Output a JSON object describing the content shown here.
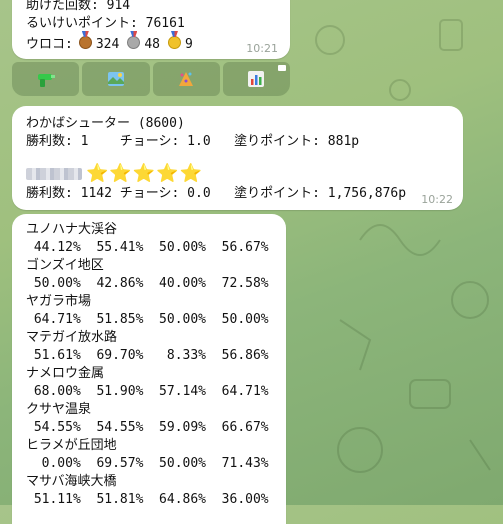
{
  "msg1": {
    "help_count": "助けた回数: 914",
    "points": "るいけいポイント: 76161",
    "scales_label": "ウロコ:",
    "bronze": "324",
    "silver": "48",
    "gold": "9",
    "time": "10:21"
  },
  "keyboard": {
    "buttons": [
      {
        "icon": "green-squirt-gun-icon"
      },
      {
        "icon": "map-stage-icon"
      },
      {
        "icon": "festival-icon"
      },
      {
        "icon": "bar-chart-icon"
      }
    ]
  },
  "msg2": {
    "weapon": "わかばシューター (8600)",
    "line2": "勝利数: 1    チョーシ: 1.0   塗りポイント: 881p",
    "stars": "⭐⭐⭐⭐⭐",
    "line4": "勝利数: 1142 チョーシ: 0.0   塗りポイント: 1,756,876p",
    "time": "10:22"
  },
  "msg3": {
    "stages": [
      {
        "name": "ユノハナ大渓谷",
        "rates": " 44.12%  55.41%  50.00%  56.67%"
      },
      {
        "name": "ゴンズイ地区",
        "rates": " 50.00%  42.86%  40.00%  72.58%"
      },
      {
        "name": "ヤガラ市場",
        "rates": " 64.71%  51.85%  50.00%  50.00%"
      },
      {
        "name": "マテガイ放水路",
        "rates": " 51.61%  69.70%   8.33%  56.86%"
      },
      {
        "name": "ナメロウ金属",
        "rates": " 68.00%  51.90%  57.14%  64.71%"
      },
      {
        "name": "クサヤ温泉",
        "rates": " 54.55%  54.55%  59.09%  66.67%"
      },
      {
        "name": "ヒラメが丘団地",
        "rates": "  0.00%  69.57%  50.00%  71.43%"
      },
      {
        "name": "マサバ海峡大橋",
        "rates": " 51.11%  51.81%  64.86%  36.00%"
      }
    ]
  }
}
